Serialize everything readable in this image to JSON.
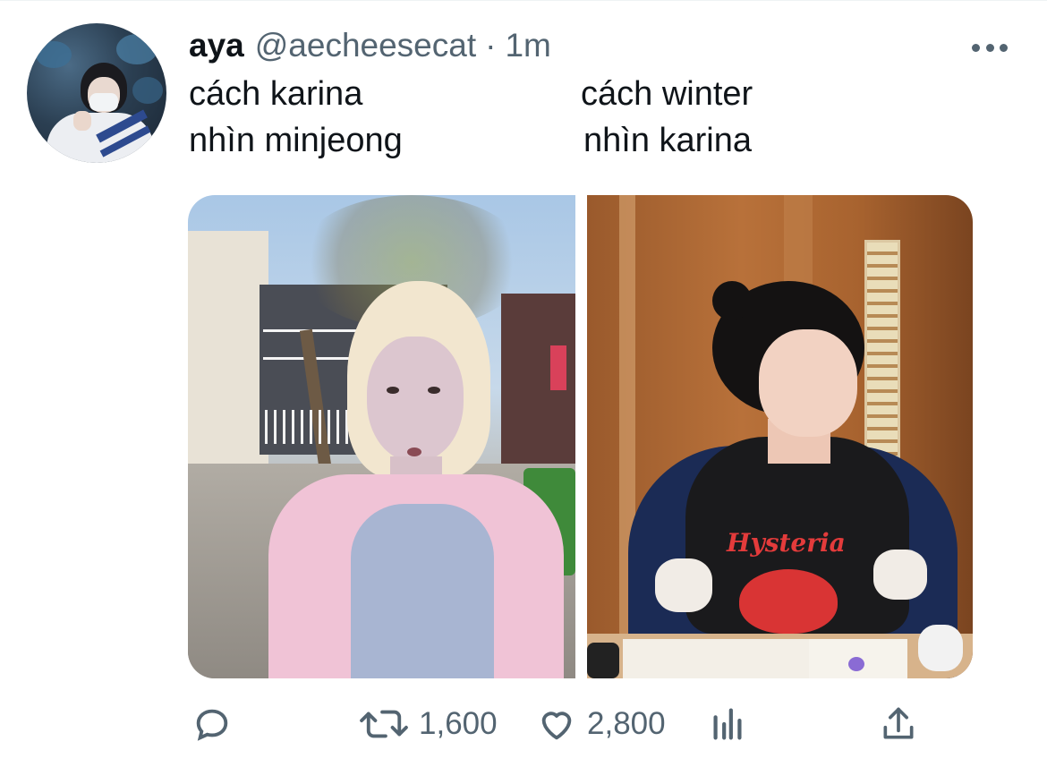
{
  "tweet": {
    "author_name": "aya",
    "author_handle": "@aecheesecat",
    "separator": "·",
    "time": "1m",
    "text_left_line1": "cách karina",
    "text_left_line2": "nhìn minjeong",
    "text_right_line1": "cách winter",
    "text_right_line2": "nhìn karina"
  },
  "media": {
    "left_image_text": "",
    "right_image_shirt_text": "Hysteria"
  },
  "actions": {
    "reply_count": "",
    "retweet_count": "1,600",
    "like_count": "2,800"
  },
  "icons": [
    "more-icon",
    "reply-icon",
    "retweet-icon",
    "like-icon",
    "analytics-icon",
    "share-icon"
  ],
  "colors": {
    "text_primary": "#0f1419",
    "text_secondary": "#536471",
    "background": "#ffffff"
  }
}
